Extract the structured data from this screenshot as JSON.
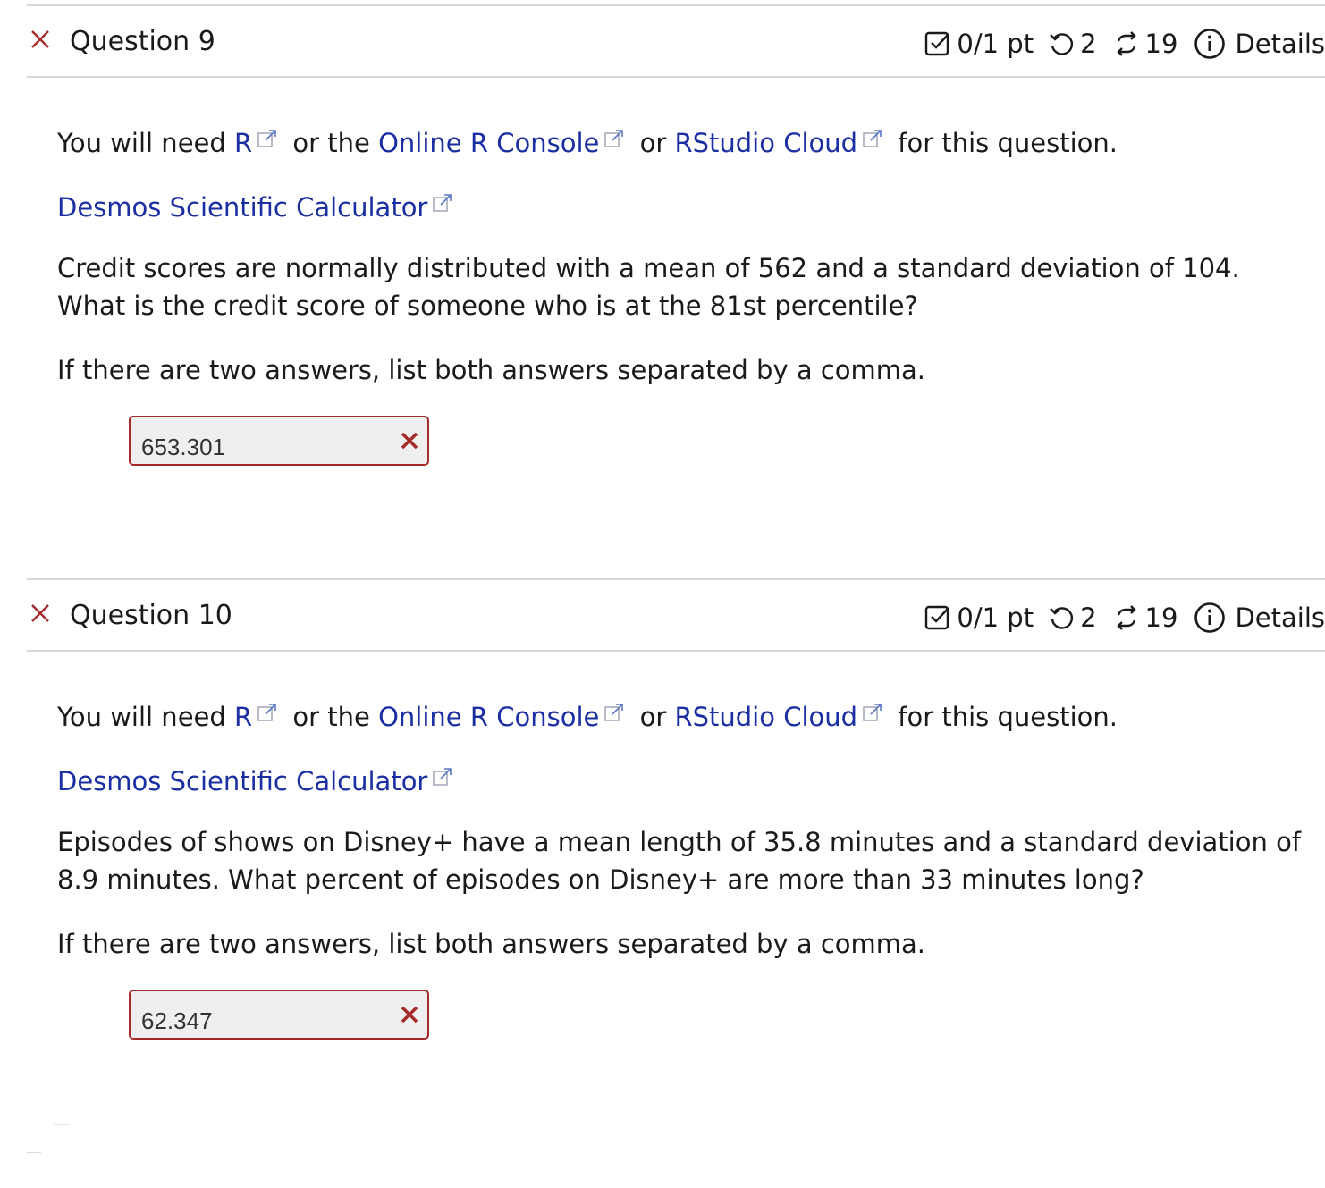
{
  "colors": {
    "link": "#1b2fa3",
    "error": "#a52a2a",
    "divider": "#d6d6d6",
    "input_bg": "#efefef"
  },
  "questions": [
    {
      "status_icon": "incorrect-x-icon",
      "title": "Question 9",
      "score": "0/1 pt",
      "tries": "2",
      "regenerations": "19",
      "details_label": "Details",
      "resources": {
        "prefix": "You will need",
        "r_link": "R",
        "or_the": "or the",
        "console_link": "Online R Console",
        "or": "or",
        "cloud_link": "RStudio Cloud",
        "suffix": "for this question."
      },
      "calculator_link": "Desmos Scientific Calculator",
      "prompt": "Credit scores are normally distributed with a mean of 562 and a standard deviation of 104. What is the credit score of someone who is at the 81st percentile?",
      "hint": "If there are two answers, list both answers separated by a comma.",
      "answer_value": "653.301",
      "answer_status": "incorrect"
    },
    {
      "status_icon": "incorrect-x-icon",
      "title": "Question 10",
      "score": "0/1 pt",
      "tries": "2",
      "regenerations": "19",
      "details_label": "Details",
      "resources": {
        "prefix": "You will need",
        "r_link": "R",
        "or_the": "or the",
        "console_link": "Online R Console",
        "or": "or",
        "cloud_link": "RStudio Cloud",
        "suffix": "for this question."
      },
      "calculator_link": "Desmos Scientific Calculator",
      "prompt": "Episodes of shows on Disney+ have a mean length of 35.8 minutes and a standard deviation of 8.9 minutes. What percent of episodes on Disney+ are more than 33 minutes long?",
      "hint": "If there are two answers, list both answers separated by a comma.",
      "answer_value": "62.347",
      "answer_status": "incorrect"
    }
  ]
}
